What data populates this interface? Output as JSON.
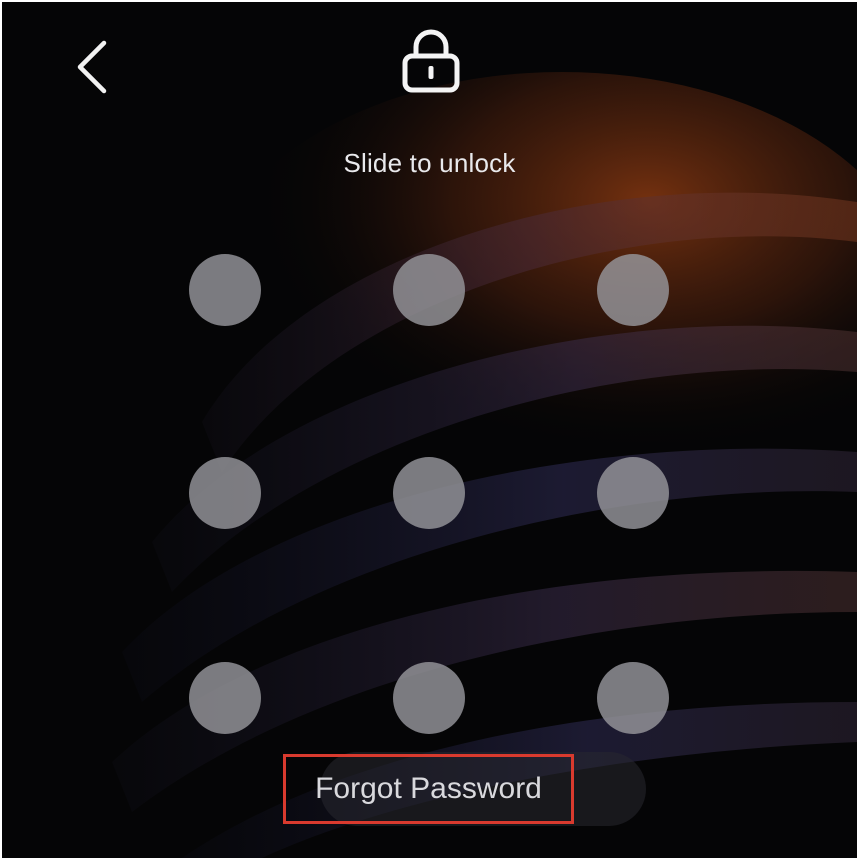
{
  "header": {
    "back_icon": "chevron-left-icon",
    "lock_icon": "padlock-icon",
    "title": "Slide to unlock"
  },
  "pattern_grid": {
    "rows": 3,
    "columns": 3,
    "dot_count": 9
  },
  "footer": {
    "forgot_password_label": "Forgot Password"
  },
  "colors": {
    "background": "#050506",
    "text": "#e9e9ec",
    "dot": "#96969b",
    "highlight_border": "#d93a2e",
    "wallpaper_accent": "#6b2a12"
  }
}
